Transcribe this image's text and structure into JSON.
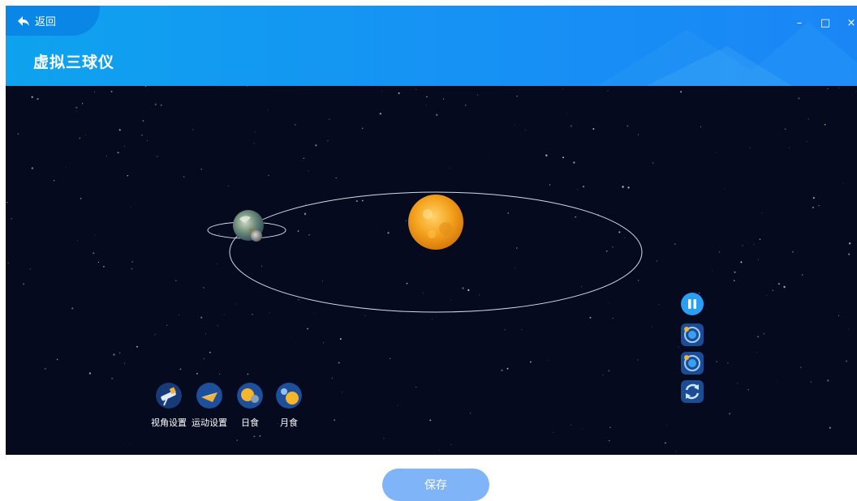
{
  "header": {
    "back_label": "返回",
    "title": "虚拟三球仪",
    "window_controls": {
      "minimize": "–",
      "maximize": "□",
      "close": "×"
    }
  },
  "toolbar": [
    {
      "label": "视角设置",
      "icon": "telescope-icon"
    },
    {
      "label": "运动设置",
      "icon": "motion-icon"
    },
    {
      "label": "日食",
      "icon": "solar-eclipse-icon"
    },
    {
      "label": "月食",
      "icon": "lunar-eclipse-icon"
    }
  ],
  "right_controls": [
    "pause-icon",
    "orbit-view-icon",
    "orbit-view-icon",
    "reset-icon"
  ],
  "footer": {
    "save_label": "保存"
  },
  "colors": {
    "accent": "#1a8ff2",
    "space": "#050a1f",
    "save": "#7fb4f8"
  }
}
